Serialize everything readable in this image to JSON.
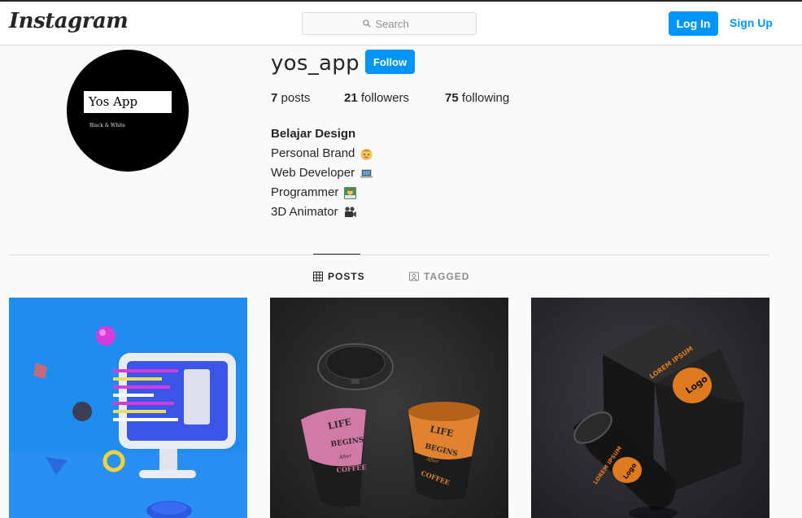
{
  "header": {
    "logo_text": "Instagram",
    "search_placeholder": "Search",
    "login_label": "Log In",
    "signup_label": "Sign Up"
  },
  "profile": {
    "username": "yos_app",
    "follow_label": "Follow",
    "avatar": {
      "title": "Yos App",
      "subtitle": "Black & White"
    },
    "stats": {
      "posts_count": "7",
      "posts_label": "posts",
      "followers_count": "21",
      "followers_label": "followers",
      "following_count": "75",
      "following_label": "following"
    },
    "bio": {
      "name": "Belajar Design",
      "lines": [
        {
          "text": "Personal Brand",
          "icon": "boy-face-emoji"
        },
        {
          "text": "Web Developer",
          "icon": "laptop-emoji"
        },
        {
          "text": "Programmer",
          "icon": "technologist-emoji"
        },
        {
          "text": "3D Animator",
          "icon": "movie-camera-emoji"
        }
      ]
    }
  },
  "tabs": [
    {
      "label": "POSTS",
      "icon": "grid-icon",
      "active": true
    },
    {
      "label": "TAGGED",
      "icon": "tag-icon",
      "active": false
    }
  ],
  "posts": [
    {
      "kind": "3d-computer-illustration",
      "background": "#1f8cf0"
    },
    {
      "kind": "coffee-cups-mockup",
      "background": "#2b2b2b",
      "cup_text": [
        "LIFE",
        "BEGINS",
        "After",
        "COFFEE"
      ]
    },
    {
      "kind": "packaging-mockup",
      "background": "#2a2a30",
      "box_text": "LOREM IPSUM",
      "logo_text": "Logo"
    }
  ],
  "colors": {
    "accent": "#0095f6",
    "border": "#dbdbdb",
    "background": "#fafafa",
    "muted": "#8e8e8e"
  }
}
